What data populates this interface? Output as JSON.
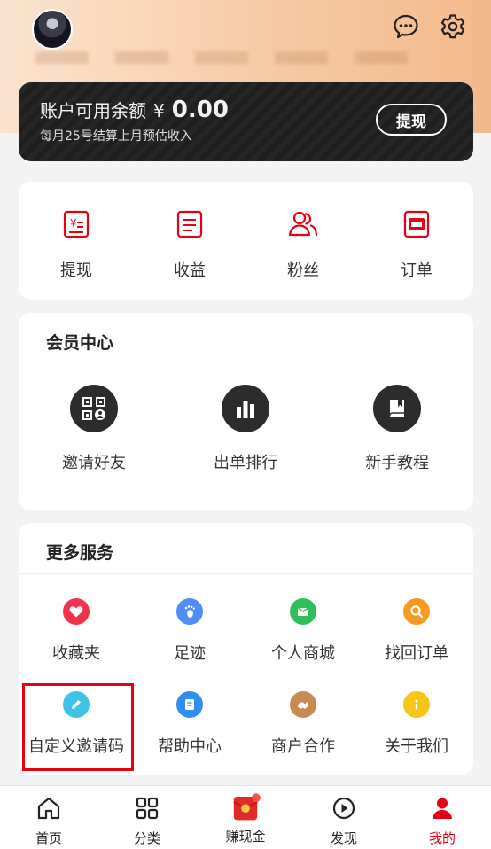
{
  "balance": {
    "title": "账户可用余额",
    "currency": "¥",
    "amount": "0.00",
    "subtitle": "每月25号结算上月预估收入",
    "withdraw_button": "提现"
  },
  "quick_actions": [
    {
      "label": "提现",
      "icon": "withdraw-icon"
    },
    {
      "label": "收益",
      "icon": "income-icon"
    },
    {
      "label": "粉丝",
      "icon": "fans-icon"
    },
    {
      "label": "订单",
      "icon": "order-icon"
    }
  ],
  "member_center": {
    "title": "会员中心",
    "items": [
      {
        "label": "邀请好友",
        "icon": "qrcode-icon"
      },
      {
        "label": "出单排行",
        "icon": "bar-chart-icon"
      },
      {
        "label": "新手教程",
        "icon": "book-icon"
      }
    ]
  },
  "more_services": {
    "title": "更多服务",
    "items": [
      {
        "label": "收藏夹",
        "icon": "heart-icon",
        "color": "#f0324a"
      },
      {
        "label": "足迹",
        "icon": "footprint-icon",
        "color": "#4f8ef5"
      },
      {
        "label": "个人商城",
        "icon": "store-icon",
        "color": "#2fbf5b"
      },
      {
        "label": "找回订单",
        "icon": "search-icon",
        "color": "#f79a22"
      },
      {
        "label": "自定义邀请码",
        "icon": "pencil-icon",
        "color": "#3ec3e6"
      },
      {
        "label": "帮助中心",
        "icon": "document-icon",
        "color": "#2f8ef0"
      },
      {
        "label": "商户合作",
        "icon": "handshake-icon",
        "color": "#c98a4f"
      },
      {
        "label": "关于我们",
        "icon": "info-icon",
        "color": "#f5c518"
      }
    ]
  },
  "tabbar": [
    {
      "label": "首页",
      "icon": "home-icon"
    },
    {
      "label": "分类",
      "icon": "category-icon"
    },
    {
      "label": "赚现金",
      "icon": "red-envelope-icon"
    },
    {
      "label": "发现",
      "icon": "play-icon"
    },
    {
      "label": "我的",
      "icon": "profile-icon",
      "active": true
    }
  ],
  "colors": {
    "accent": "#e60012",
    "header_gradient_start": "#fbe3cf",
    "header_gradient_end": "#f3b98b",
    "card_dark": "#1f1f1f"
  }
}
